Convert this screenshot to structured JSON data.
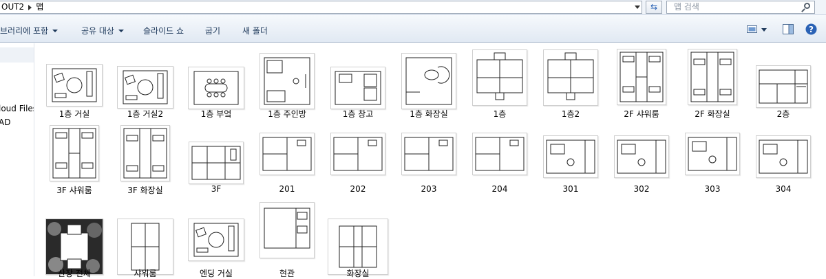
{
  "address": {
    "segments": [
      "OUT2",
      "맵"
    ]
  },
  "search": {
    "placeholder": "맵 검색"
  },
  "toolbar": {
    "library": "브러리에 포함",
    "share": "공유 대상",
    "slideshow": "슬라이드 쇼",
    "burn": "굽기",
    "new_folder": "새 폴더"
  },
  "sidebar": {
    "items": [
      "loud Files",
      "AD"
    ]
  },
  "files": [
    {
      "label": "1층 거실"
    },
    {
      "label": "1층 거실2"
    },
    {
      "label": "1층 부엌"
    },
    {
      "label": "1층 주인방"
    },
    {
      "label": "1층 창고"
    },
    {
      "label": "1층 화장실"
    },
    {
      "label": "1층"
    },
    {
      "label": "1층2"
    },
    {
      "label": "2F 샤워룸"
    },
    {
      "label": "2F 화장실"
    },
    {
      "label": "2층"
    },
    {
      "label": "3F 샤워룸"
    },
    {
      "label": "3F 화장실"
    },
    {
      "label": "3F"
    },
    {
      "label": "201"
    },
    {
      "label": "202"
    },
    {
      "label": "203"
    },
    {
      "label": "204"
    },
    {
      "label": "301"
    },
    {
      "label": "302"
    },
    {
      "label": "303"
    },
    {
      "label": "304"
    },
    {
      "label": "산장 전체"
    },
    {
      "label": "샤워룸"
    },
    {
      "label": "엔딩 거실"
    },
    {
      "label": "현관"
    },
    {
      "label": "화장실"
    }
  ]
}
